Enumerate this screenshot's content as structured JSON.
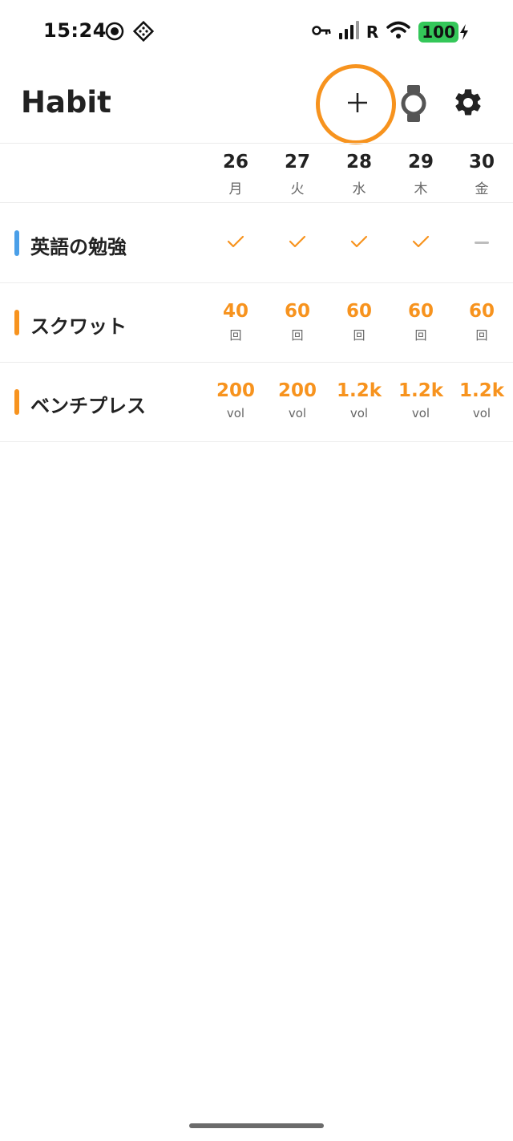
{
  "status_bar": {
    "time": "15:24",
    "left_icons": [
      "record-icon",
      "app-grid-icon"
    ],
    "right_icons": [
      "key-icon",
      "signal-icon",
      "wifi-icon",
      "battery-icon"
    ],
    "signal_label": "R",
    "battery": "100"
  },
  "header": {
    "title": "Habit",
    "actions": [
      "add-icon",
      "watch-icon",
      "gear-icon"
    ],
    "highlight_color": "#f7931e"
  },
  "dates": [
    {
      "day": "26",
      "weekday": "月"
    },
    {
      "day": "27",
      "weekday": "火"
    },
    {
      "day": "28",
      "weekday": "水"
    },
    {
      "day": "29",
      "weekday": "木"
    },
    {
      "day": "30",
      "weekday": "金"
    }
  ],
  "habits": [
    {
      "name": "英語の勉強",
      "color": "#4a9fe8",
      "cells": [
        {
          "type": "check"
        },
        {
          "type": "check"
        },
        {
          "type": "check"
        },
        {
          "type": "check"
        },
        {
          "type": "empty"
        }
      ]
    },
    {
      "name": "スクワット",
      "color": "#f7931e",
      "cells": [
        {
          "type": "value",
          "value": "40",
          "unit": "回"
        },
        {
          "type": "value",
          "value": "60",
          "unit": "回"
        },
        {
          "type": "value",
          "value": "60",
          "unit": "回"
        },
        {
          "type": "value",
          "value": "60",
          "unit": "回"
        },
        {
          "type": "value",
          "value": "60",
          "unit": "回"
        }
      ]
    },
    {
      "name": "ベンチプレス",
      "color": "#f7931e",
      "cells": [
        {
          "type": "value",
          "value": "200",
          "unit": "vol"
        },
        {
          "type": "value",
          "value": "200",
          "unit": "vol"
        },
        {
          "type": "value",
          "value": "1.2k",
          "unit": "vol"
        },
        {
          "type": "value",
          "value": "1.2k",
          "unit": "vol"
        },
        {
          "type": "value",
          "value": "1.2k",
          "unit": "vol"
        }
      ]
    }
  ],
  "accent_color": "#f7931e"
}
